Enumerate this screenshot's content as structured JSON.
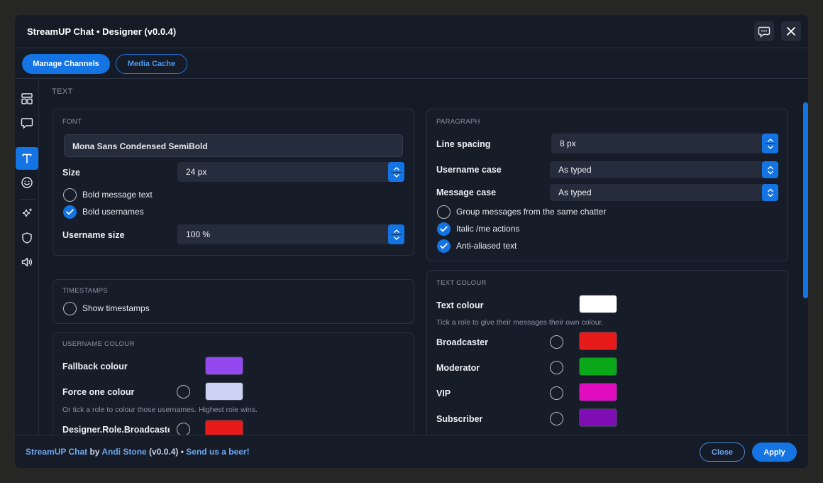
{
  "window": {
    "title": "StreamUP Chat • Designer (v0.0.4)"
  },
  "toolbar": {
    "manage_channels": "Manage Channels",
    "media_cache": "Media Cache"
  },
  "sidebar": {
    "items": [
      {
        "icon": "layout-icon",
        "active": false
      },
      {
        "icon": "chat-bubble-icon",
        "active": false
      },
      {
        "icon": "text-icon",
        "active": true
      },
      {
        "icon": "smiley-icon",
        "active": false
      },
      {
        "icon": "sparkle-icon",
        "active": false
      },
      {
        "icon": "shield-icon",
        "active": false
      },
      {
        "icon": "speaker-icon",
        "active": false
      }
    ]
  },
  "section": {
    "title": "TEXT"
  },
  "font": {
    "header": "FONT",
    "font_name": "Mona Sans Condensed SemiBold",
    "size_label": "Size",
    "size_value": "24 px",
    "bold_message_label": "Bold message text",
    "bold_message_checked": false,
    "bold_usernames_label": "Bold usernames",
    "bold_usernames_checked": true,
    "username_size_label": "Username size",
    "username_size_value": "100 %"
  },
  "timestamps": {
    "header": "TIMESTAMPS",
    "show_label": "Show timestamps",
    "show_checked": false
  },
  "username_colour": {
    "header": "USERNAME COLOUR",
    "fallback_label": "Fallback colour",
    "fallback_color": "#9448f0",
    "force_label": "Force one colour",
    "force_checked": false,
    "force_color": "#ccd3f2",
    "hint": "Or tick a role to colour those usernames. Highest role wins.",
    "broadcaster_label": "Designer.Role.Broadcaste",
    "broadcaster_checked": false,
    "broadcaster_color": "#e81b1b",
    "next_color": "#0aa818"
  },
  "paragraph": {
    "header": "PARAGRAPH",
    "line_spacing_label": "Line spacing",
    "line_spacing_value": "8 px",
    "username_case_label": "Username case",
    "username_case_value": "As typed",
    "message_case_label": "Message case",
    "message_case_value": "As typed",
    "group_label": "Group messages from the same chatter",
    "group_checked": false,
    "italic_label": "Italic /me actions",
    "italic_checked": true,
    "antialiased_label": "Anti-aliased text",
    "antialiased_checked": true
  },
  "text_colour": {
    "header": "TEXT COLOUR",
    "text_colour_label": "Text colour",
    "text_colour_value": "#ffffff",
    "hint": "Tick a role to give their messages their own colour.",
    "roles": [
      {
        "label": "Broadcaster",
        "checked": false,
        "color": "#e81b1b"
      },
      {
        "label": "Moderator",
        "checked": false,
        "color": "#0aa818"
      },
      {
        "label": "VIP",
        "checked": false,
        "color": "#e10bc0"
      },
      {
        "label": "Subscriber",
        "checked": false,
        "color": "#7e0db3"
      }
    ]
  },
  "footer": {
    "app": "StreamUP Chat",
    "by": " by ",
    "author": "Andi Stone",
    "version": " (v0.0.4) • ",
    "beer": "Send us a beer!",
    "close": "Close",
    "apply": "Apply"
  },
  "colors": {
    "accent": "#1474e3",
    "background": "#141a26"
  }
}
